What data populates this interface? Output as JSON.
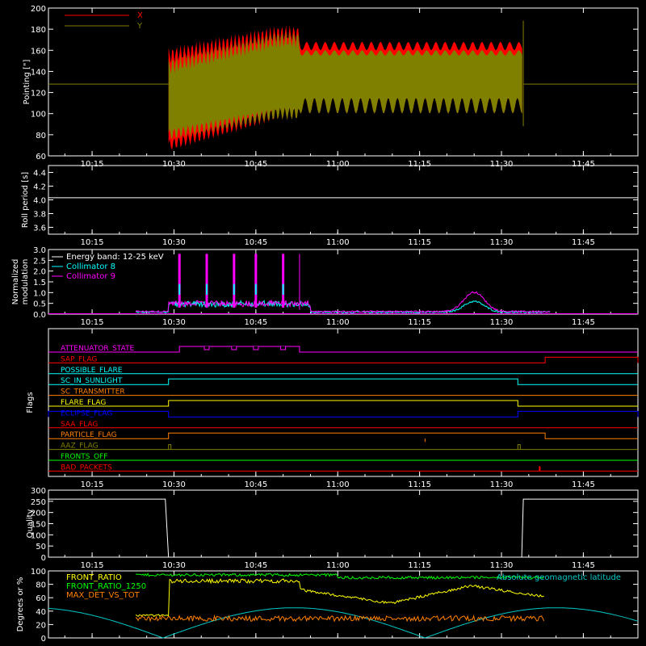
{
  "time_ticks": [
    "10:15",
    "10:30",
    "10:45",
    "11:00",
    "11:15",
    "11:30",
    "11:45"
  ],
  "chart_data": [
    {
      "type": "line",
      "panel": "pointing",
      "ylabel": "Pointing [\"]",
      "yticks": [
        60,
        80,
        100,
        120,
        140,
        160,
        180,
        200
      ],
      "ylim": [
        60,
        200
      ],
      "xlim": [
        "10:07",
        "11:55"
      ],
      "legend": [
        "X",
        "Y"
      ],
      "series": [
        {
          "name": "X",
          "color": "#ff0000",
          "baseline": 128,
          "active": [
            "10:29",
            "11:34"
          ],
          "upper_early": [
            155,
            176
          ],
          "lower_early": [
            70,
            100
          ],
          "upper_late": [
            160,
            168
          ],
          "lower_late": [
            100,
            115
          ]
        },
        {
          "name": "Y",
          "color": "#808000",
          "baseline": 128,
          "active": [
            "10:29",
            "11:34"
          ],
          "upper_early": [
            145,
            170
          ],
          "lower_early": [
            80,
            100
          ],
          "upper_late": [
            155,
            160
          ],
          "lower_late": [
            100,
            115
          ]
        }
      ]
    },
    {
      "type": "line",
      "panel": "roll",
      "ylabel": "Roll period [s]",
      "yticks": [
        "3.6",
        "3.8",
        "4.0",
        "4.2",
        "4.4"
      ],
      "ylim": [
        3.5,
        4.5
      ],
      "series": [
        {
          "color": "#ffffff",
          "value": 4.03
        }
      ]
    },
    {
      "type": "line",
      "panel": "modulation",
      "ylabel": "Normalized modulation",
      "ylabel_lines": [
        "Normalized",
        "modulation"
      ],
      "yticks": [
        "0.0",
        "0.5",
        "1.0",
        "1.5",
        "2.0",
        "2.5",
        "3.0"
      ],
      "ylim": [
        0,
        3
      ],
      "legend": [
        "Energy band: 12-25 keV",
        "Collimator 8",
        "Collimator 9"
      ],
      "series": [
        {
          "name": "Collimator 8",
          "color": "#00ffff",
          "range": [
            "10:23",
            "11:39"
          ],
          "peak_time": "11:25",
          "peak": 0.5
        },
        {
          "name": "Collimator 9",
          "color": "#ff00ff",
          "range": [
            "10:23",
            "11:39"
          ],
          "spikes": [
            "10:31",
            "10:36",
            "10:41",
            "10:45",
            "10:50"
          ],
          "spike_height": 2.8,
          "peak_time": "11:25",
          "peak": 0.9
        }
      ]
    },
    {
      "type": "line",
      "panel": "flags",
      "ylabel": "Flags",
      "flags": [
        {
          "name": "ATTENUATOR_STATE",
          "color": "#ff00ff",
          "high": [
            [
              "10:31",
              "10:53"
            ]
          ]
        },
        {
          "name": "SAP_FLAG",
          "color": "#ff0000",
          "high": [
            [
              "11:38",
              "11:55"
            ]
          ]
        },
        {
          "name": "POSSIBLE_FLARE",
          "color": "#00ffff",
          "high": []
        },
        {
          "name": "SC_IN_SUNLIGHT",
          "color": "#00ffff",
          "high": [
            [
              "10:29",
              "11:33"
            ]
          ]
        },
        {
          "name": "SC_TRANSMITTER",
          "color": "#ff8000",
          "high": []
        },
        {
          "name": "FLARE_FLAG",
          "color": "#ffff00",
          "high": [
            [
              "10:29",
              "11:33"
            ]
          ]
        },
        {
          "name": "ECLIPSE_FLAG",
          "color": "#0000ff",
          "high": [
            [
              "10:07",
              "10:29"
            ],
            [
              "11:33",
              "11:55"
            ]
          ]
        },
        {
          "name": "SAA_FLAG",
          "color": "#ff0000",
          "high": []
        },
        {
          "name": "PARTICLE_FLAG",
          "color": "#ff8000",
          "high": [
            [
              "10:29",
              "11:38"
            ]
          ]
        },
        {
          "name": "AAZ_FLAG",
          "color": "#808000",
          "high": []
        },
        {
          "name": "FRONTS_OFF",
          "color": "#00ff00",
          "high": []
        },
        {
          "name": "BAD_PACKETS",
          "color": "#ff0000",
          "high": []
        }
      ]
    },
    {
      "type": "line",
      "panel": "quality",
      "ylabel": "Quality",
      "yticks": [
        0,
        50,
        100,
        150,
        200,
        250,
        300
      ],
      "ylim": [
        0,
        300
      ],
      "series": [
        {
          "color": "#ffffff",
          "high_value": 260,
          "low_range": [
            "10:29",
            "11:34"
          ]
        }
      ]
    },
    {
      "type": "line",
      "panel": "front",
      "ylabel": "Degrees or %",
      "yticks": [
        0,
        20,
        40,
        60,
        80,
        100
      ],
      "ylim": [
        0,
        100
      ],
      "legend": [
        "FRONT_RATIO",
        "FRONT_RATIO_1250",
        "MAX_DET_VS_TOT"
      ],
      "legend_right": "Absolute geomagnetic latitude",
      "series": [
        {
          "name": "FRONT_RATIO",
          "color": "#ffff00"
        },
        {
          "name": "FRONT_RATIO_1250",
          "color": "#00ff00"
        },
        {
          "name": "MAX_DET_VS_TOT",
          "color": "#ff8000"
        },
        {
          "name": "Absolute geomagnetic latitude",
          "color": "#00c8c8"
        }
      ]
    }
  ]
}
